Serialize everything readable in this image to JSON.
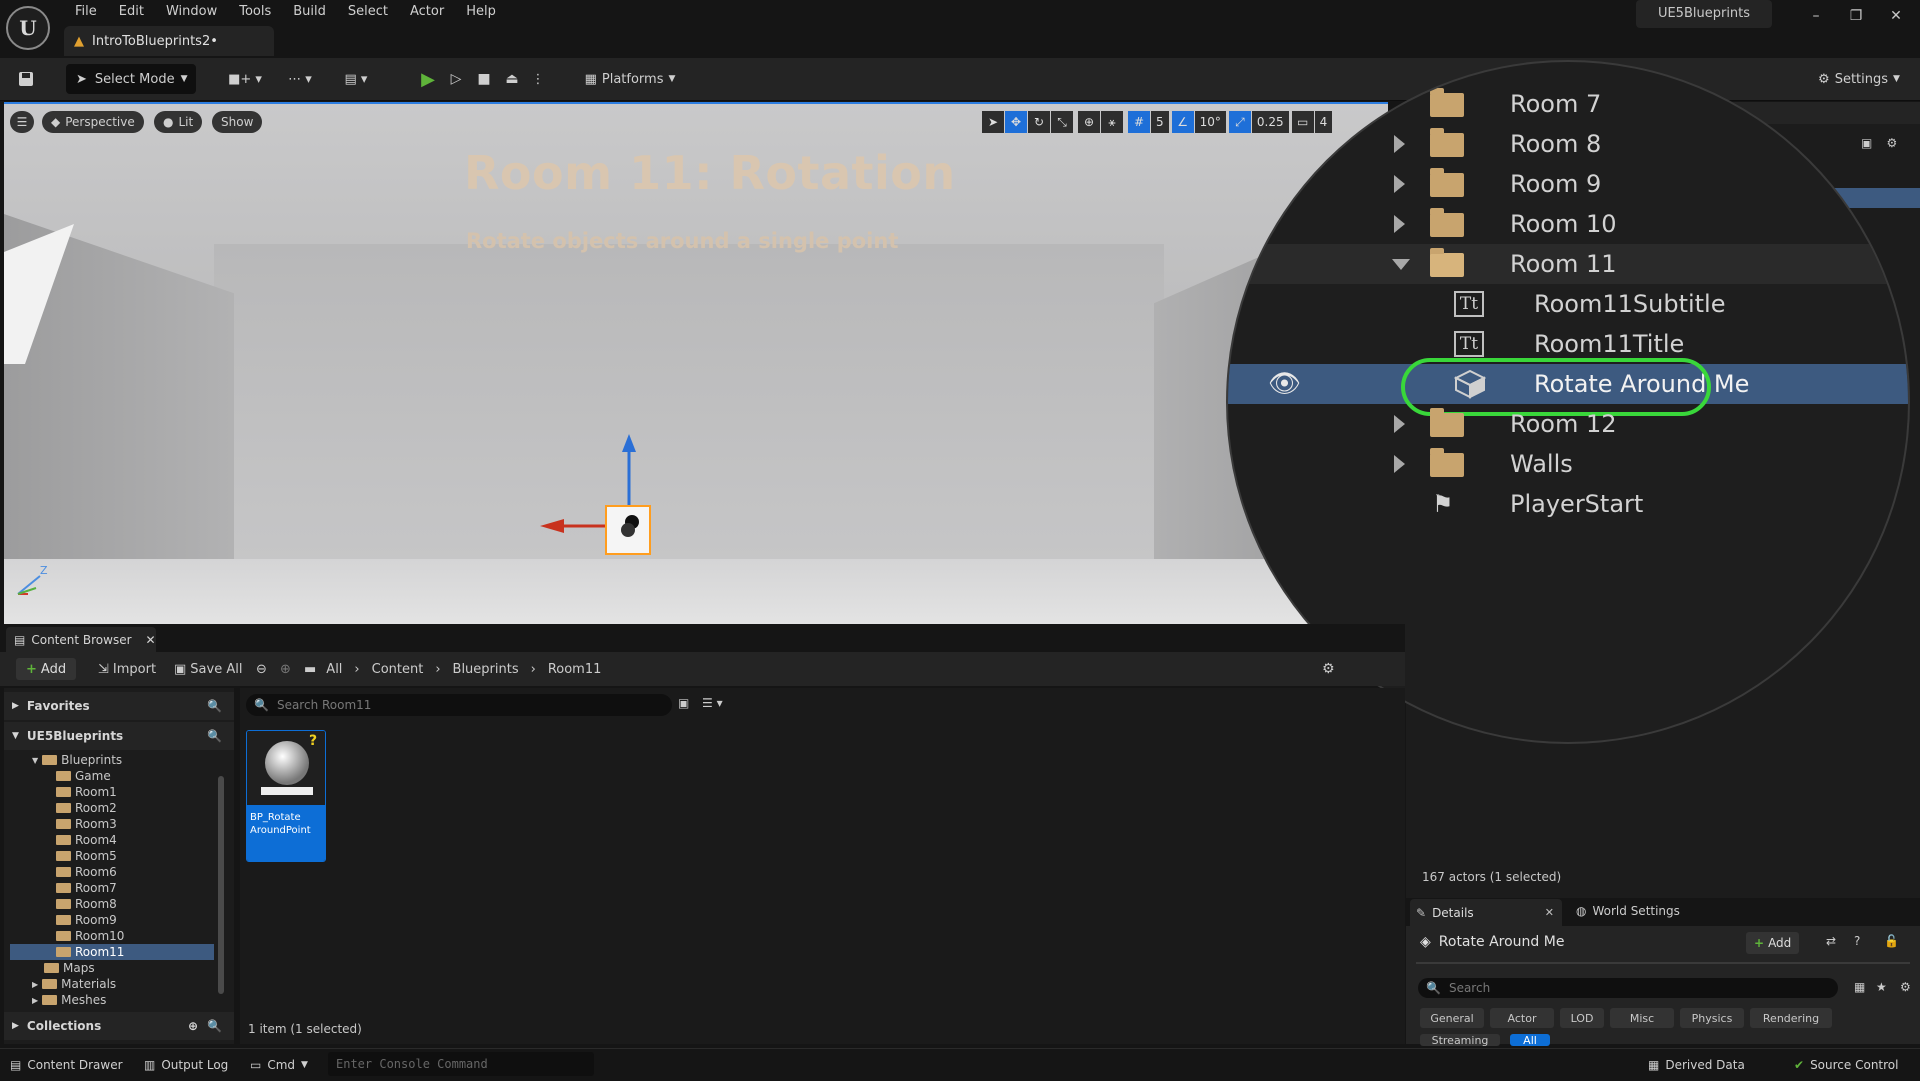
{
  "app": {
    "project_name": "UE5Blueprints",
    "document_tab": "IntroToBlueprints2•",
    "menu": [
      "File",
      "Edit",
      "Window",
      "Tools",
      "Build",
      "Select",
      "Actor",
      "Help"
    ]
  },
  "toolbar": {
    "select_mode": "Select Mode",
    "platforms": "Platforms",
    "settings": "Settings"
  },
  "viewport": {
    "perspective": "Perspective",
    "lit": "Lit",
    "show": "Show",
    "grid_snap": "5",
    "rot_snap": "10°",
    "scale_snap": "0.25",
    "cam_speed": "4",
    "room_title": "Room 11: Rotation",
    "room_subtitle": "Rotate objects around a single point",
    "axis_z": "Z"
  },
  "outliner": {
    "rows": [
      "Room 7",
      "Room 8",
      "Room 9",
      "Room 10",
      "Room 11",
      "Room11Subtitle",
      "Room11Title",
      "Rotate Around Me",
      "Room 12",
      "Walls",
      "PlayerStart"
    ],
    "status": "167 actors (1 selected)"
  },
  "content_browser": {
    "tab": "Content Browser",
    "add": "Add",
    "import": "Import",
    "save_all": "Save All",
    "breadcrumb": [
      "All",
      "Content",
      "Blueprints",
      "Room11"
    ],
    "favorites": "Favorites",
    "project_root": "UE5Blueprints",
    "collections": "Collections",
    "search_placeholder": "Search Room11",
    "tree": [
      "Blueprints",
      "Game",
      "Room1",
      "Room2",
      "Room3",
      "Room4",
      "Room5",
      "Room6",
      "Room7",
      "Room8",
      "Room9",
      "Room10",
      "Room11",
      "Maps",
      "Materials",
      "Meshes"
    ],
    "asset_name_1": "BP_Rotate",
    "asset_name_2": "AroundPoint",
    "count": "1 item (1 selected)"
  },
  "details": {
    "tab": "Details",
    "world_settings": "World Settings",
    "selected_actor": "Rotate Around Me",
    "add": "Add",
    "search_placeholder": "Search",
    "filters": [
      "General",
      "Actor",
      "LOD",
      "Misc",
      "Physics",
      "Rendering"
    ],
    "filters_row2": [
      "Streaming",
      "All"
    ]
  },
  "statusbar": {
    "content_drawer": "Content Drawer",
    "output_log": "Output Log",
    "cmd": "Cmd",
    "console_placeholder": "Enter Console Command",
    "derived_data": "Derived Data",
    "source_control": "Source Control"
  },
  "colors": {
    "accent": "#0d6ed6",
    "highlight_ring": "#39d73a",
    "play": "#5fb43a",
    "room_text": "#d9c6b0"
  }
}
